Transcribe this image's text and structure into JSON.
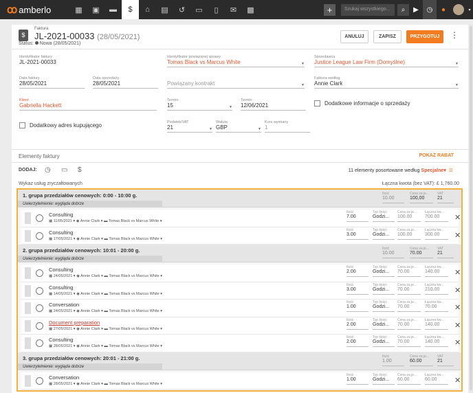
{
  "app": {
    "logo_text": "amberlo",
    "search_placeholder": "Szukaj wszystkiego...",
    "accent_color": "#f47c20"
  },
  "header": {
    "doc_type": "Faktura",
    "doc_number": "JL-2021-00033",
    "doc_date": "(28/05/2021)",
    "status_label": "Status:",
    "status_value": "Nowa (28/05/2021)",
    "btn_cancel": "ANULUJ",
    "btn_save": "ZAPISZ",
    "btn_prepare": "PRZYGOTUJ"
  },
  "form": {
    "invoice_id": {
      "label": "Identyfikator faktury",
      "value": "JL-2021-00033"
    },
    "case_id": {
      "label": "Identyfikator powiązanej sprawy",
      "value": "Tomas Black vs Marcus White"
    },
    "sale": {
      "label": "Sprzedawca",
      "value": "Justice League Law Firm (Domyślne)"
    },
    "invoice_date": {
      "label": "Data faktury",
      "value": "28/05/2021"
    },
    "sale_date": {
      "label": "Data sprzedaży",
      "value": "28/05/2021"
    },
    "contract": {
      "placeholder": "Powiązany kontrakt"
    },
    "invoice_by": {
      "label": "Faktura według",
      "value": "Annie Clark"
    },
    "client": {
      "label": "Klient",
      "value": "Gabriella Hackett"
    },
    "term_days": {
      "label": "Termin",
      "value": "15"
    },
    "term_date": {
      "label": "Termin",
      "value": "12/06/2021"
    },
    "extra_sale_info": "Dodatkowe informacje o sprzedaży",
    "extra_buyer_address": "Dodatkowy adres kupującego",
    "vat": {
      "label": "Podatek/VAT",
      "value": "21"
    },
    "currency": {
      "label": "Waluta",
      "value": "GBP"
    },
    "rate": {
      "label": "Kurs wymiany",
      "value": "1"
    }
  },
  "items_section": {
    "title": "Elementy faktury",
    "discount_btn": "POKAŻ RABAT",
    "add_label": "DODAJ:",
    "sort_text": "11 elementy posortowane według",
    "sort_value": "Specjalne",
    "list_title": "Wykaz usług zryczałtowanych",
    "total_text": "Łączna kwota (bez VAT): £ 1,760.00"
  },
  "col_labels": {
    "qty": "Ilość",
    "type": "Typ ilości",
    "price": "Cena za je...",
    "total": "Łączna kw...",
    "vat": "VAT"
  },
  "groups": [
    {
      "title": "1. grupa przedziałów cenowych: 0:00 - 10:00 g.",
      "subtitle": "Uwierzytelnienie: wygląda dobrze",
      "qty": "10.00",
      "price": "100,00",
      "vat": "21",
      "rows": [
        {
          "name": "Consulting",
          "date": "11/05/2021",
          "user": "Annie Clark",
          "matter": "Tomas Black vs Marcus White",
          "qty": "7.00",
          "type": "Godzi...",
          "price": "100.00",
          "total": "700.00"
        },
        {
          "name": "Consulting",
          "date": "17/05/2021",
          "user": "Annie Clark",
          "matter": "Tomas Black vs Marcus White",
          "qty": "3.00",
          "type": "Godzi...",
          "price": "100.00",
          "total": "300.00"
        }
      ]
    },
    {
      "title": "2. grupa przedziałów cenowych: 10:01 - 20:00 g.",
      "subtitle": "Uwierzytelnienie: wygląda dobrze",
      "qty": "10.00",
      "price": "70.00",
      "vat": "21",
      "rows": [
        {
          "name": "Consulting",
          "date": "24/05/2021",
          "user": "Annie Clark",
          "matter": "Tomas Black vs Marcus White",
          "qty": "2.00",
          "type": "Godzi...",
          "price": "70.00",
          "total": "140.00"
        },
        {
          "name": "Consulting",
          "date": "14/05/2021",
          "user": "Annie Clark",
          "matter": "Tomas Black vs Marcus White",
          "qty": "3.00",
          "type": "Godzi...",
          "price": "70.00",
          "total": "210.00"
        },
        {
          "name": "Conversation",
          "date": "24/05/2021",
          "user": "Annie Clark",
          "matter": "Tomas Black vs Marcus White",
          "qty": "1.00",
          "type": "Godzi...",
          "price": "70.00",
          "total": "70.00"
        },
        {
          "name": "Document preparation",
          "date": "27/05/2021",
          "user": "Annie Clark",
          "matter": "Tomas Black vs Marcus White",
          "qty": "2.00",
          "type": "Godzi...",
          "price": "70.00",
          "total": "140.00"
        },
        {
          "name": "Consulting",
          "date": "28/05/2021",
          "user": "Annie Clark",
          "matter": "Tomas Black vs Marcus White",
          "qty": "2.00",
          "type": "Godzi...",
          "price": "70.00",
          "total": "140.00"
        }
      ]
    },
    {
      "title": "3. grupa przedziałów cenowych: 20:01 - 21:00 g.",
      "subtitle": "Uwierzytelnienie: wygląda dobrze",
      "qty": "1.00",
      "price": "60.00",
      "vat": "21",
      "rows": [
        {
          "name": "Conversation",
          "date": "28/05/2021",
          "user": "Annie Clark",
          "matter": "Tomas Black vs Marcus White",
          "qty": "1.00",
          "type": "Godzi...",
          "price": "60.00",
          "total": "60.00"
        }
      ]
    }
  ]
}
